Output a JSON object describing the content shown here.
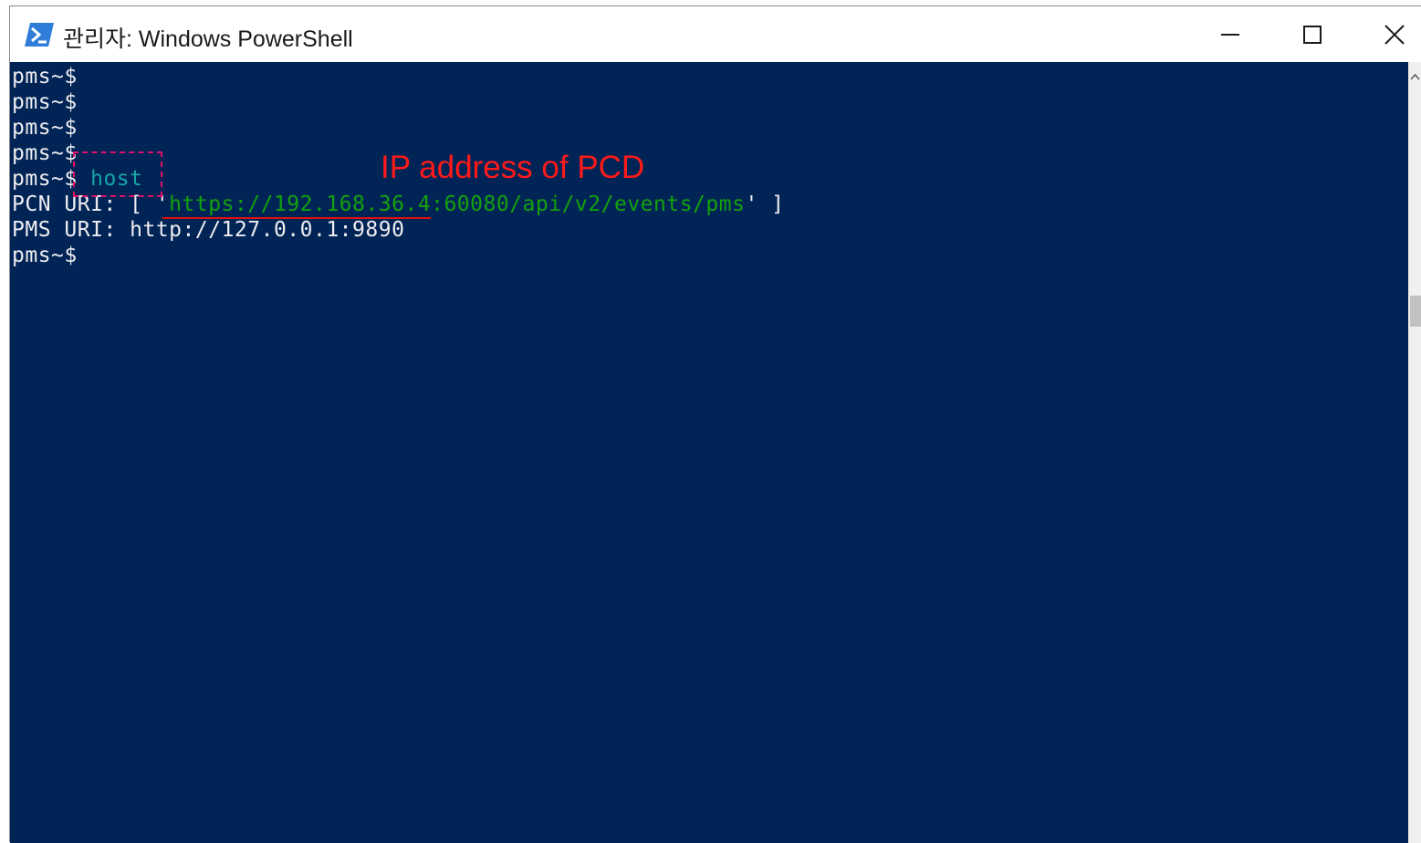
{
  "window": {
    "title": "관리자: Windows PowerShell"
  },
  "console": {
    "prompt": "pms~$",
    "command": "host",
    "pcn_line_prefix": "PCN URI: [ '",
    "pcn_uri": "https://192.168.36.4:60080/api/v2/events/pms",
    "pcn_line_suffix": "' ]",
    "pms_line": "PMS URI: http://127.0.0.1:9890"
  },
  "annotation": {
    "label": "IP address of PCD"
  },
  "colors": {
    "console_bg": "#012456",
    "console_fg": "#eeedf0",
    "command": "#16a6a6",
    "uri": "#13a10e",
    "annotation": "#ff1a1a"
  }
}
